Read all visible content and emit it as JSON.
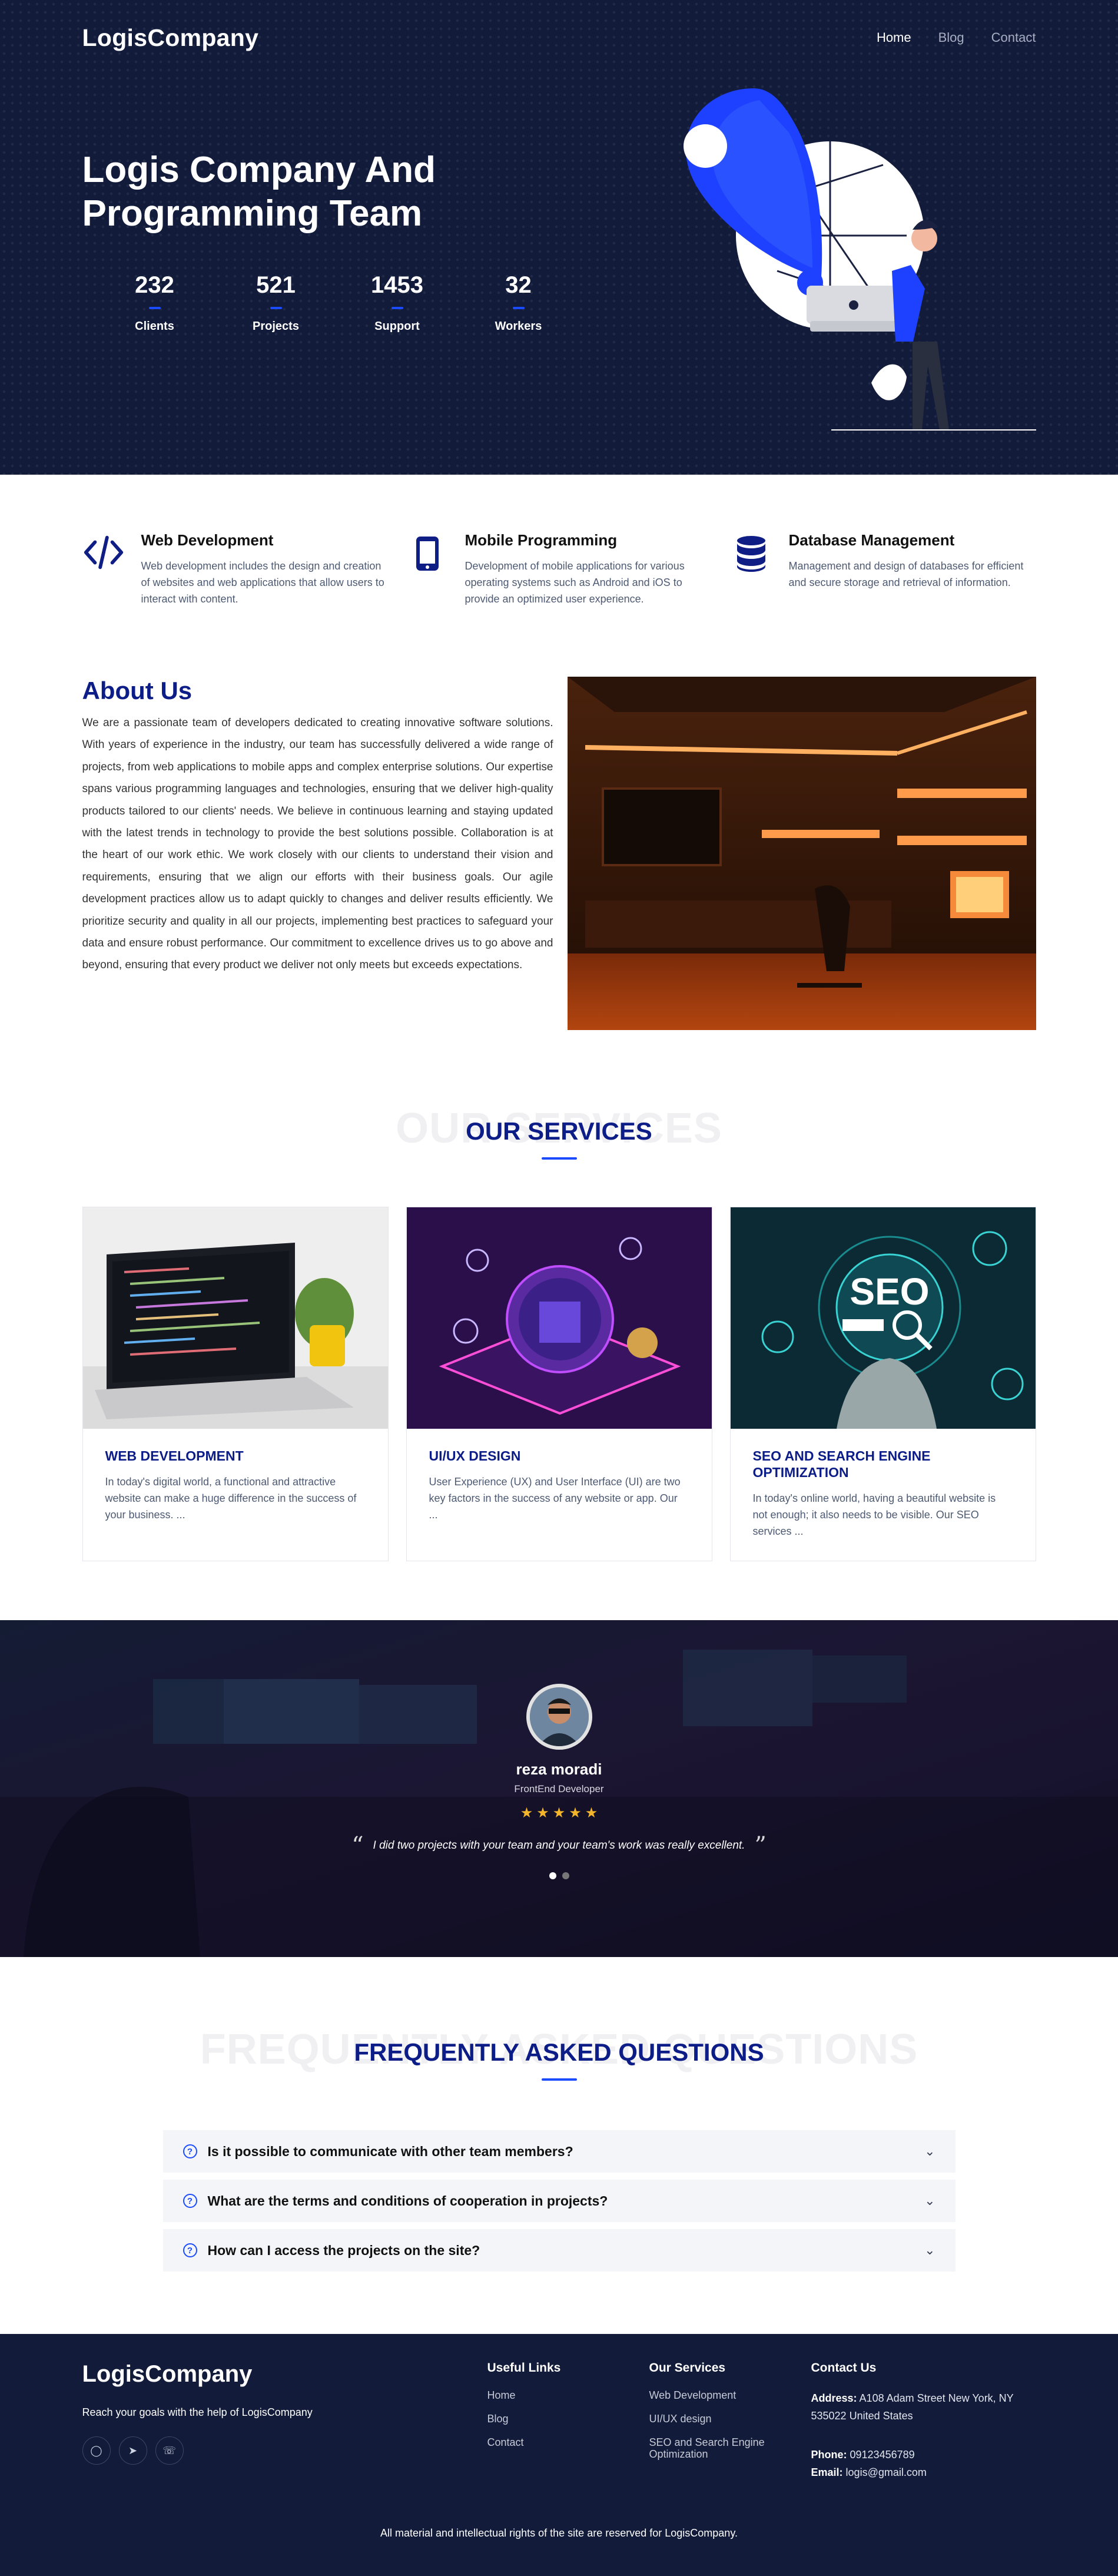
{
  "header": {
    "logo": "LogisCompany",
    "nav": [
      "Home",
      "Blog",
      "Contact"
    ]
  },
  "hero": {
    "title": "Logis Company And Programming Team",
    "stats": [
      {
        "value": "232",
        "label": "Clients"
      },
      {
        "value": "521",
        "label": "Projects"
      },
      {
        "value": "1453",
        "label": "Support"
      },
      {
        "value": "32",
        "label": "Workers"
      }
    ]
  },
  "features": [
    {
      "icon": "code-icon",
      "title": "Web Development",
      "text": "Web development includes the design and creation of websites and web applications that allow users to interact with content."
    },
    {
      "icon": "mobile-icon",
      "title": "Mobile Programming",
      "text": "Development of mobile applications for various operating systems such as Android and iOS to provide an optimized user experience."
    },
    {
      "icon": "database-icon",
      "title": "Database Management",
      "text": "Management and design of databases for efficient and secure storage and retrieval of information."
    }
  ],
  "about": {
    "title": "About Us",
    "text": "We are a passionate team of developers dedicated to creating innovative software solutions. With years of experience in the industry, our team has successfully delivered a wide range of projects, from web applications to mobile apps and complex enterprise solutions. Our expertise spans various programming languages and technologies, ensuring that we deliver high-quality products tailored to our clients' needs. We believe in continuous learning and staying updated with the latest trends in technology to provide the best solutions possible. Collaboration is at the heart of our work ethic. We work closely with our clients to understand their vision and requirements, ensuring that we align our efforts with their business goals. Our agile development practices allow us to adapt quickly to changes and deliver results efficiently. We prioritize security and quality in all our projects, implementing best practices to safeguard your data and ensure robust performance. Our commitment to excellence drives us to go above and beyond, ensuring that every product we deliver not only meets but exceeds expectations."
  },
  "services": {
    "ghost": "OUR SERVICES",
    "title": "OUR SERVICES",
    "cards": [
      {
        "title": "WEB DEVELOPMENT",
        "text": "In today's digital world, a functional and attractive website can make a huge difference in the success of your business. ..."
      },
      {
        "title": "UI/UX DESIGN",
        "text": "User Experience (UX) and User Interface (UI) are two key factors in the success of any website or app. Our ..."
      },
      {
        "title": "SEO AND SEARCH ENGINE OPTIMIZATION",
        "text": "In today's online world, having a beautiful website is not enough; it also needs to be visible. Our SEO services ..."
      }
    ]
  },
  "testimonial": {
    "name": "reza moradi",
    "role": "FrontEnd Developer",
    "rating": 5,
    "quote": "I did two projects with your team and your team's work was really excellent.",
    "open_quote": "“",
    "close_quote": "”"
  },
  "faq": {
    "ghost": "FREQUENTLY ASKED QUESTIONS",
    "title": "FREQUENTLY ASKED QUESTIONS",
    "items": [
      "Is it possible to communicate with other team members?",
      "What are the terms and conditions of cooperation in projects?",
      "How can I access the projects on the site?"
    ]
  },
  "footer": {
    "logo": "LogisCompany",
    "tagline": "Reach your goals with the help of LogisCompany",
    "useful_title": "Useful Links",
    "useful": [
      "Home",
      "Blog",
      "Contact"
    ],
    "services_title": "Our Services",
    "services": [
      "Web Development",
      "UI/UX design",
      "SEO and Search Engine Optimization"
    ],
    "contact_title": "Contact Us",
    "address_label": "Address:",
    "address": "A108 Adam Street New York, NY 535022 United States",
    "phone_label": "Phone:",
    "phone": "09123456789",
    "email_label": "Email:",
    "email": "logis@gmail.com",
    "copyright": "All material and intellectual rights of the site are reserved for LogisCompany."
  },
  "colors": {
    "navy": "#121c3a",
    "accent": "#1b4bff",
    "heading": "#0d1d87",
    "star": "#f4b52a"
  }
}
